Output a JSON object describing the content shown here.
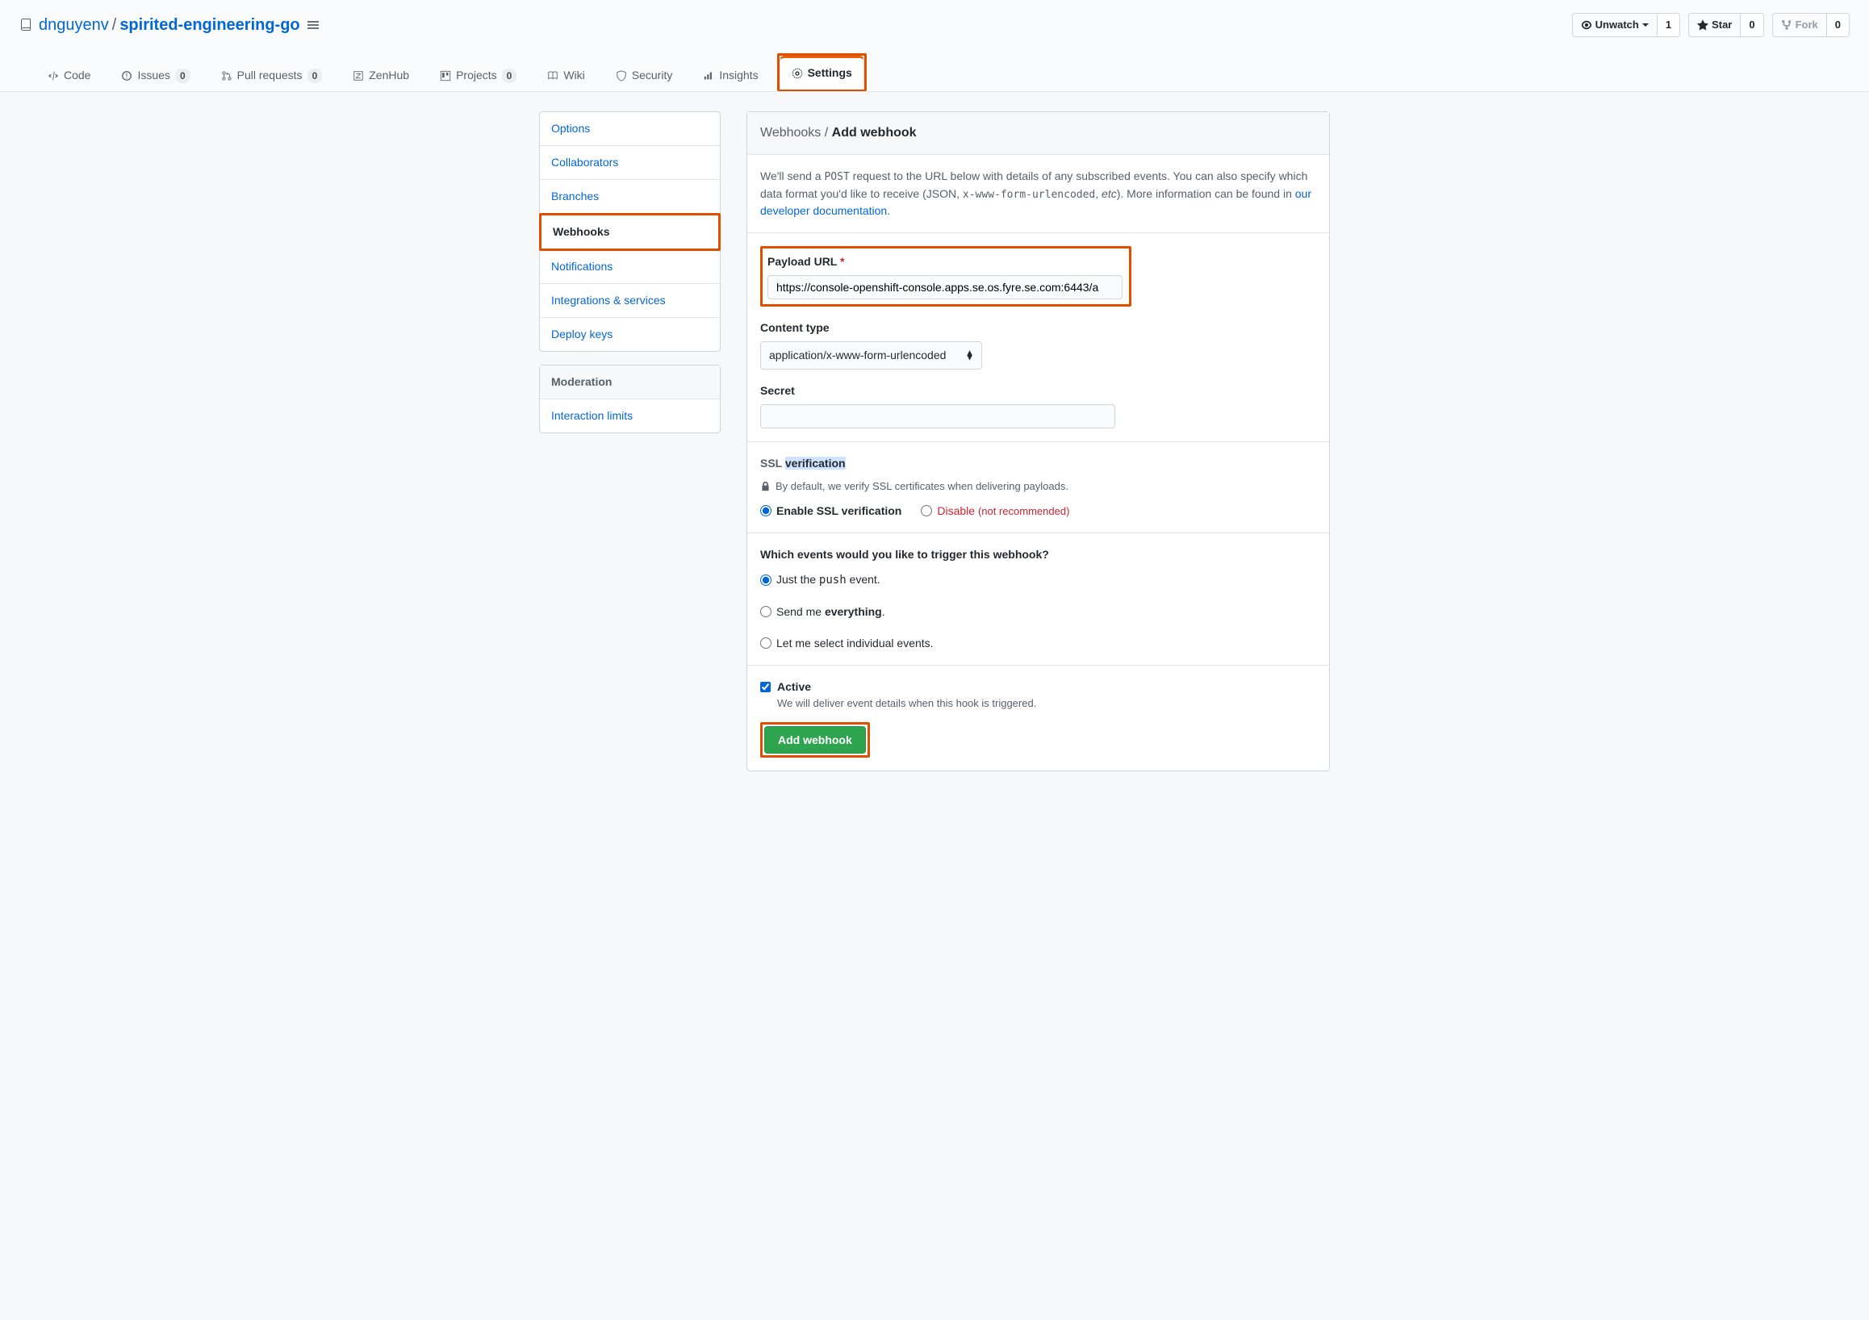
{
  "repo": {
    "owner": "dnguyenv",
    "name": "spirited-engineering-go"
  },
  "actions": {
    "unwatch": {
      "label": "Unwatch",
      "count": "1"
    },
    "star": {
      "label": "Star",
      "count": "0"
    },
    "fork": {
      "label": "Fork",
      "count": "0"
    }
  },
  "tabs": {
    "code": "Code",
    "issues": {
      "label": "Issues",
      "count": "0"
    },
    "pulls": {
      "label": "Pull requests",
      "count": "0"
    },
    "zenhub": "ZenHub",
    "projects": {
      "label": "Projects",
      "count": "0"
    },
    "wiki": "Wiki",
    "security": "Security",
    "insights": "Insights",
    "settings": "Settings"
  },
  "sidebar": {
    "options": "Options",
    "collaborators": "Collaborators",
    "branches": "Branches",
    "webhooks": "Webhooks",
    "notifications": "Notifications",
    "integrations": "Integrations & services",
    "deploykeys": "Deploy keys",
    "moderation_header": "Moderation",
    "interaction": "Interaction limits"
  },
  "page": {
    "breadcrumb_root": "Webhooks",
    "breadcrumb_sep": " / ",
    "breadcrumb_current": "Add webhook",
    "intro_pre": "We'll send a ",
    "intro_post_code": "POST",
    "intro_post1": " request to the URL below with details of any subscribed events. You can also specify which data format you'd like to receive (JSON, ",
    "intro_code2": "x-www-form-urlencoded",
    "intro_post2": ", ",
    "intro_etc": "etc",
    "intro_post3": "). More information can be found in ",
    "intro_link": "our developer documentation",
    "intro_end": "."
  },
  "form": {
    "payload_label": "Payload URL",
    "payload_value": "https://console-openshift-console.apps.se.os.fyre.se.com:6443/a",
    "content_type_label": "Content type",
    "content_type_value": "application/x-www-form-urlencoded",
    "secret_label": "Secret",
    "secret_value": "",
    "ssl_label_pre": "SSL ",
    "ssl_label_hl": "verification",
    "ssl_hint": "By default, we verify SSL certificates when delivering payloads.",
    "ssl_enable": "Enable SSL verification",
    "ssl_disable": "Disable",
    "ssl_disable_note": "(not recommended)",
    "events_question": "Which events would you like to trigger this webhook?",
    "event_push_pre": "Just the ",
    "event_push_code": "push",
    "event_push_post": " event.",
    "event_everything_pre": "Send me ",
    "event_everything_bold": "everything",
    "event_everything_post": ".",
    "event_individual": "Let me select individual events.",
    "active_label": "Active",
    "active_hint": "We will deliver event details when this hook is triggered.",
    "submit": "Add webhook"
  }
}
